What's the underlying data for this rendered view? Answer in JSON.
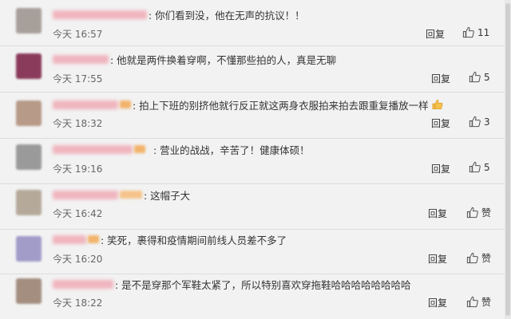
{
  "comments": [
    {
      "text": ": 你们看到没，他在无声的抗议！！",
      "time": "今天 16:57",
      "reply": "回复",
      "likes": "11",
      "has_emoji": false,
      "avatar_color": "#a79f9a",
      "name_color": "#f0b5be"
    },
    {
      "text": ": 他就是两件换着穿啊，不懂那些拍的人，真是无聊",
      "time": "今天 17:55",
      "reply": "回复",
      "likes": "5",
      "has_emoji": false,
      "avatar_color": "#8a3a5a",
      "name_color": "#f0b5be"
    },
    {
      "text": ": 拍上下班的别挤他就行反正就这两身衣服拍来拍去跟重复播放一样",
      "time": "今天 18:32",
      "reply": "回复",
      "likes": "3",
      "has_emoji": true,
      "avatar_color": "#b79a88",
      "name_color": "#f0b5be"
    },
    {
      "text": ": 营业的战战，辛苦了！健康体硕！",
      "time": "今天 19:16",
      "reply": "回复",
      "likes": "5",
      "has_emoji": false,
      "avatar_color": "#9a9a9a",
      "name_color": "#f0b5be"
    },
    {
      "text": ": 这帽子大",
      "time": "今天 16:42",
      "reply": "回复",
      "likes": "赞",
      "has_emoji": false,
      "avatar_color": "#b5a99a",
      "name_color": "#f0b5be"
    },
    {
      "text": ": 笑死，裹得和疫情期间前线人员差不多了",
      "time": "今天 16:20",
      "reply": "回复",
      "likes": "赞",
      "has_emoji": false,
      "avatar_color": "#a29cc8",
      "name_color": "#f0b5be"
    },
    {
      "text": ": 是不是穿那个军鞋太紧了，所以特别喜欢穿拖鞋哈哈哈哈哈哈哈哈",
      "time": "今天 18:22",
      "reply": "回复",
      "likes": "赞",
      "has_emoji": false,
      "avatar_color": "#a38e80",
      "name_color": "#f0b5be"
    }
  ],
  "icons": {
    "like": "thumbs-up-icon"
  }
}
